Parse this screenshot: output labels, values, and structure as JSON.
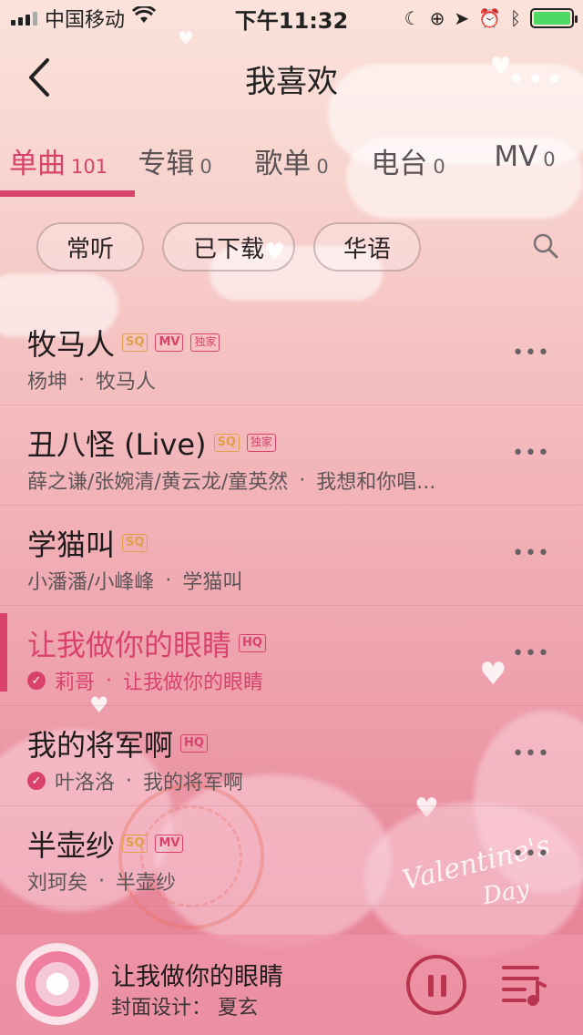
{
  "status_bar": {
    "carrier": "中国移动",
    "time": "下午11:32",
    "battery_level": 1.0
  },
  "nav": {
    "title": "我喜欢",
    "back_icon": "chevron-left-icon",
    "more_icon": "ellipsis-icon"
  },
  "tabs": [
    {
      "label": "单曲",
      "count": "101",
      "active": true
    },
    {
      "label": "专辑",
      "count": "0"
    },
    {
      "label": "歌单",
      "count": "0"
    },
    {
      "label": "电台",
      "count": "0"
    },
    {
      "label": "MV",
      "count": "0"
    }
  ],
  "filters": [
    "常听",
    "已下载",
    "华语"
  ],
  "songs": [
    {
      "title": "牧马人",
      "badges": [
        "SQ",
        "MV",
        "独家"
      ],
      "artist": "杨坤",
      "album": "牧马人"
    },
    {
      "title": "丑八怪 (Live)",
      "badges": [
        "SQ",
        "独家"
      ],
      "artist": "薛之谦/张婉清/黄云龙/童英然",
      "album": "我想和你唱..."
    },
    {
      "title": "学猫叫",
      "badges": [
        "SQ"
      ],
      "artist": "小潘潘/小峰峰",
      "album": "学猫叫"
    },
    {
      "title": "让我做你的眼睛",
      "badges": [
        "HQ"
      ],
      "artist": "莉哥",
      "album": "让我做你的眼睛",
      "playing": true,
      "downloaded": true
    },
    {
      "title": "我的将军啊",
      "badges": [
        "HQ"
      ],
      "artist": "叶洛洛",
      "album": "我的将军啊",
      "downloaded": true
    },
    {
      "title": "半壶纱",
      "badges": [
        "SQ",
        "MV"
      ],
      "artist": "刘珂矣",
      "album": "半壶纱"
    }
  ],
  "separator": "·",
  "player": {
    "title": "让我做你的眼睛",
    "subtitle": "封面设计： 夏玄"
  },
  "colors": {
    "accent": "#d9436b",
    "sq_badge": "#e0a04a"
  }
}
